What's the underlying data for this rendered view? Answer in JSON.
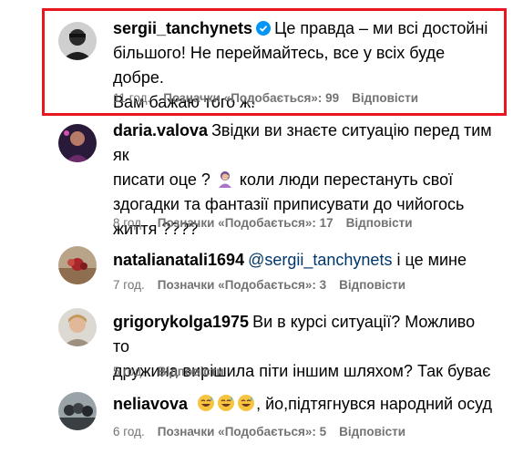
{
  "comments": [
    {
      "username": "sergii_tanchynets",
      "verified": true,
      "text_lines": [
        "Це правда – ми всі достойні",
        "більшого! Не переймайтесь, все у всіх буде добре.",
        "Вам бажаю того ж!"
      ],
      "time": "11 год.",
      "likes": "Позначки «Подобається»: 99",
      "reply": "Відповісти",
      "highlighted": true
    },
    {
      "username": "daria.valova",
      "text_line1": "Звідки ви знаєте ситуацію перед тим як",
      "text_line2a": "писати оце ?",
      "text_line2b": "коли люди перестануть свої",
      "text_line3": "здогадки та фантазії приписувати до чийогось",
      "text_line4": "життя ????",
      "time": "8 год.",
      "likes": "Позначки «Подобається»: 17",
      "reply": "Відповісти"
    },
    {
      "username": "natalianatali1694",
      "mention": "@sergii_tanchynets",
      "text": "і це мине",
      "time": "7 год.",
      "likes": "Позначки «Подобається»: 3",
      "reply": "Відповісти"
    },
    {
      "username": "grigorykolga1975",
      "text_line1": "Ви в курсі ситуації? Можливо то",
      "text_line2": "дружина вирішила піти іншим шляхом? Так буває",
      "time": "5 год.",
      "reply": "Відповісти"
    },
    {
      "username": "neliavova",
      "text": ", йо,підтягнувся народний осуд",
      "emoji": [
        "grinning-sweat-emoji",
        "grinning-sweat-emoji",
        "grinning-sweat-emoji"
      ],
      "time": "6 год.",
      "likes": "Позначки «Подобається»: 5",
      "reply": "Відповісти"
    }
  ],
  "colors": {
    "highlight_border": "#e8161e",
    "meta_text": "#737373",
    "mention": "#00376b",
    "verified_badge": "#0095f6"
  }
}
